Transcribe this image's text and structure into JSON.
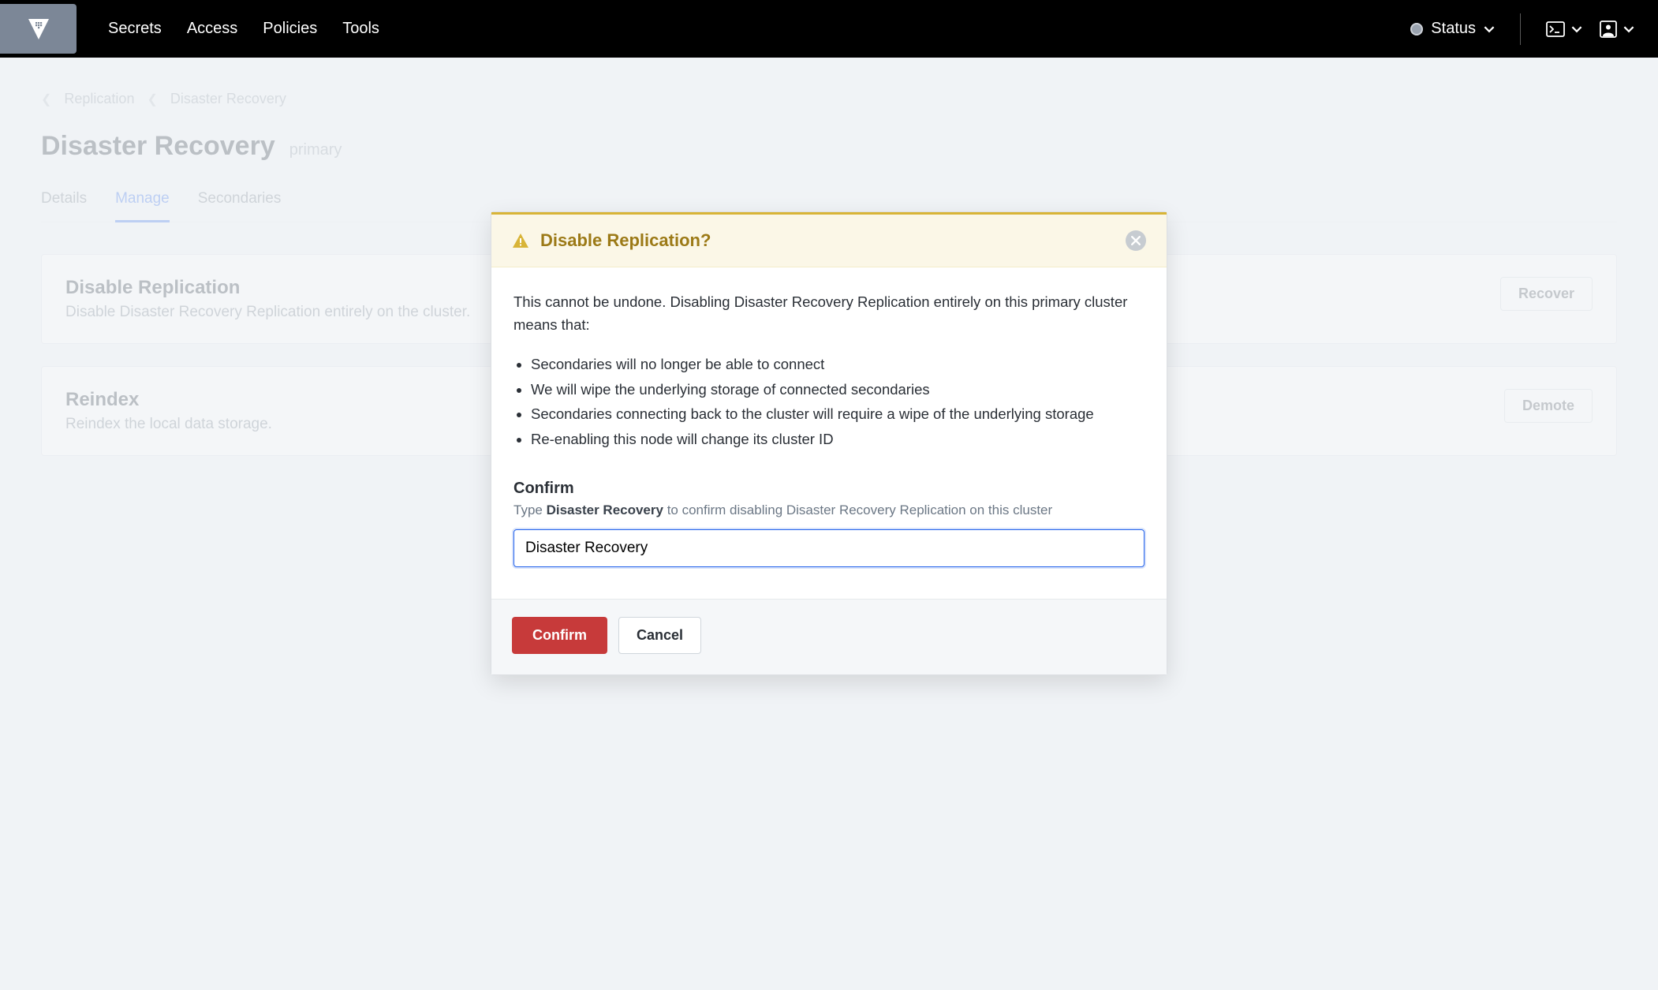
{
  "nav": {
    "links": [
      "Secrets",
      "Access",
      "Policies",
      "Tools"
    ],
    "status_label": "Status"
  },
  "breadcrumbs": {
    "items": [
      "Replication",
      "Disaster Recovery"
    ]
  },
  "page": {
    "title": "Disaster Recovery",
    "subtitle": "primary",
    "tabs": [
      "Details",
      "Manage",
      "Secondaries"
    ],
    "active_tab_index": 1
  },
  "cards": [
    {
      "title": "Disable Replication",
      "desc": "Disable Disaster Recovery Replication entirely on the cluster.",
      "button": "Recover"
    },
    {
      "title": "Reindex",
      "desc": "Reindex the local data storage.",
      "button": "Demote"
    }
  ],
  "modal": {
    "title": "Disable Replication?",
    "body_intro": "This cannot be undone. Disabling Disaster Recovery Replication entirely on this primary cluster means that:",
    "bullets": [
      "Secondaries will no longer be able to connect",
      "We will wipe the underlying storage of connected secondaries",
      "Secondaries connecting back to the cluster will require a wipe of the underlying storage",
      "Re-enabling this node will change its cluster ID"
    ],
    "confirm_heading": "Confirm",
    "confirm_hint_pre": "Type ",
    "confirm_hint_bold": "Disaster Recovery",
    "confirm_hint_post": " to confirm disabling Disaster Recovery Replication on this cluster",
    "confirm_value": "Disaster Recovery",
    "confirm_button": "Confirm",
    "cancel_button": "Cancel"
  }
}
